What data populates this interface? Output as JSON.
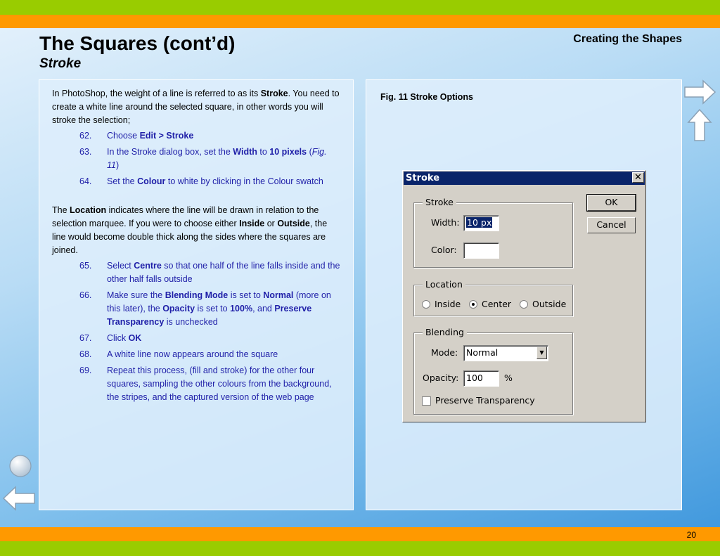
{
  "header": {
    "title": "The Squares (cont’d)",
    "subtitle": "Stroke",
    "section": "Creating the Shapes"
  },
  "page_number": "20",
  "left": {
    "intro_a": "In PhotoShop, the weight of a line is referred to as its ",
    "intro_b": "Stroke",
    "intro_c": ". You need to create a white line around the selected square, in other words you will stroke the selection;",
    "steps1": [
      {
        "num": "62.",
        "t1": "Choose ",
        "b1": "Edit > Stroke"
      },
      {
        "num": "63.",
        "t1": "In the Stroke dialog box, set the ",
        "b1": "Width",
        "t2": " to ",
        "b2": "10 pixels",
        "t3": " (",
        "i1": "Fig. 11",
        "t4": ")"
      },
      {
        "num": "64.",
        "t1": "Set the ",
        "b1": "Colour",
        "t2": " to white by clicking in the Colour swatch"
      }
    ],
    "loc_a": "The ",
    "loc_b": "Location",
    "loc_c": " indicates where the line will be drawn in relation to the selection marquee. If you were to choose either ",
    "loc_d": "Inside",
    "loc_e": " or ",
    "loc_f": "Outside",
    "loc_g": ", the line would become double thick along the sides where the squares are joined.",
    "steps2": [
      {
        "num": "65.",
        "t1": "Select ",
        "b1": "Centre",
        "t2": " so that one half of the line falls inside and the other half falls outside"
      },
      {
        "num": "66.",
        "t1": "Make sure the ",
        "b1": "Blending Mode",
        "t2": " is set to ",
        "b2": "Normal",
        "t3": " (more on this later), the ",
        "b3": "Opacity",
        "t4": " is set to ",
        "b4": "100%",
        "t5": ", and ",
        "b5": "Preserve Transparency",
        "t6": " is unchecked"
      },
      {
        "num": "67.",
        "t1": "Click ",
        "b1": "OK"
      },
      {
        "num": "68.",
        "t1": "A white line now appears around the square"
      },
      {
        "num": "69.",
        "t1": "Repeat this process, (fill and stroke) for the other four squares, sampling the other colours from the background, the stripes, and the captured version of the web page"
      }
    ]
  },
  "figure": {
    "caption": "Fig. 11  Stroke Options",
    "dialog": {
      "title": "Stroke",
      "close": "✕",
      "ok": "OK",
      "cancel": "Cancel",
      "stroke_group": "Stroke",
      "width_label": "Width:",
      "width_value": "10 px",
      "color_label": "Color:",
      "location_group": "Location",
      "inside": "Inside",
      "center": "Center",
      "outside": "Outside",
      "selected_location": "Center",
      "blending_group": "Blending",
      "mode_label": "Mode:",
      "mode_value": "Normal",
      "opacity_label": "Opacity:",
      "opacity_value": "100",
      "opacity_unit": "%",
      "preserve": "Preserve Transparency",
      "preserve_checked": false
    }
  },
  "colors": {
    "step_text": "#1f1fa8",
    "band_green": "#99cc00",
    "band_orange": "#ff9900"
  }
}
